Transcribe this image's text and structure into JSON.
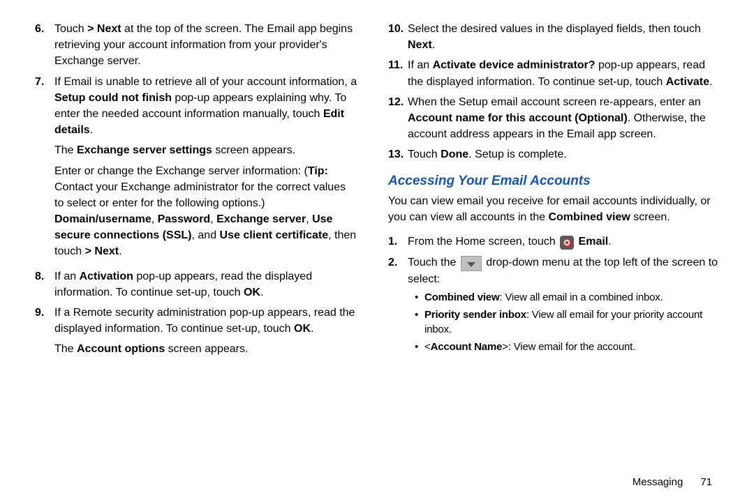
{
  "left": {
    "items": [
      {
        "num": "6.",
        "segs": [
          {
            "t": "Touch "
          },
          {
            "t": "> Next",
            "b": true
          },
          {
            "t": " at the top of the screen. The Email app begins retrieving your account information from your provider's Exchange server."
          }
        ]
      },
      {
        "num": "7.",
        "segs": [
          {
            "t": "If Email is unable to retrieve all of your account information, a "
          },
          {
            "t": "Setup could not finish",
            "b": true
          },
          {
            "t": " pop-up appears explaining why. To enter the needed account information manually, touch "
          },
          {
            "t": "Edit details",
            "b": true
          },
          {
            "t": "."
          }
        ],
        "paras": [
          [
            {
              "t": "The "
            },
            {
              "t": "Exchange server settings",
              "b": true
            },
            {
              "t": " screen appears."
            }
          ],
          [
            {
              "t": "Enter or change the Exchange server information: ("
            },
            {
              "t": "Tip:",
              "b": true
            },
            {
              "t": " Contact your Exchange administrator for the correct values to select or enter for the following options.) "
            },
            {
              "t": "Domain/username",
              "b": true
            },
            {
              "t": ", "
            },
            {
              "t": "Password",
              "b": true
            },
            {
              "t": ", "
            },
            {
              "t": "Exchange server",
              "b": true
            },
            {
              "t": ", "
            },
            {
              "t": "Use secure connections (SSL)",
              "b": true
            },
            {
              "t": ", and "
            },
            {
              "t": "Use client certificate",
              "b": true
            },
            {
              "t": ", then touch "
            },
            {
              "t": "> Next",
              "b": true
            },
            {
              "t": "."
            }
          ]
        ]
      },
      {
        "num": "8.",
        "segs": [
          {
            "t": "If an "
          },
          {
            "t": "Activation",
            "b": true
          },
          {
            "t": " pop-up appears, read the displayed information. To continue set-up, touch "
          },
          {
            "t": "OK",
            "b": true
          },
          {
            "t": "."
          }
        ]
      },
      {
        "num": "9.",
        "segs": [
          {
            "t": "If a Remote security administration pop-up appears, read the displayed information. To continue set-up, touch "
          },
          {
            "t": "OK",
            "b": true
          },
          {
            "t": "."
          }
        ],
        "paras": [
          [
            {
              "t": "The "
            },
            {
              "t": "Account options",
              "b": true
            },
            {
              "t": " screen appears."
            }
          ]
        ]
      }
    ]
  },
  "right": {
    "items": [
      {
        "num": "10.",
        "segs": [
          {
            "t": "Select the desired values in the displayed fields, then touch "
          },
          {
            "t": "Next",
            "b": true
          },
          {
            "t": "."
          }
        ]
      },
      {
        "num": "11.",
        "segs": [
          {
            "t": "If an "
          },
          {
            "t": "Activate device administrator?",
            "b": true
          },
          {
            "t": " pop-up appears, read the displayed information. To continue set-up, touch "
          },
          {
            "t": "Activate",
            "b": true
          },
          {
            "t": "."
          }
        ]
      },
      {
        "num": "12.",
        "segs": [
          {
            "t": "When the Setup email account screen re-appears, enter an "
          },
          {
            "t": "Account name for this account (Optional)",
            "b": true
          },
          {
            "t": ". Otherwise, the account address appears in the Email app screen."
          }
        ]
      },
      {
        "num": "13.",
        "segs": [
          {
            "t": "Touch "
          },
          {
            "t": "Done",
            "b": true
          },
          {
            "t": ". Setup is complete."
          }
        ]
      }
    ],
    "heading": "Accessing Your Email Accounts",
    "intro": [
      {
        "t": "You can view email you receive for email accounts individually, or you can view all accounts in the "
      },
      {
        "t": "Combined view",
        "b": true
      },
      {
        "t": " screen."
      }
    ],
    "steps": [
      {
        "num": "1.",
        "segs": [
          {
            "t": "From the Home screen, touch "
          },
          {
            "icon": "email"
          },
          {
            "t": " "
          },
          {
            "t": "Email",
            "b": true
          },
          {
            "t": "."
          }
        ]
      },
      {
        "num": "2.",
        "segs": [
          {
            "t": "Touch the "
          },
          {
            "icon": "dropdown"
          },
          {
            "t": " drop-down menu at the top left of the screen to select:"
          }
        ],
        "bullets": [
          [
            {
              "t": "Combined view",
              "b": true
            },
            {
              "t": ": View all email in a combined inbox."
            }
          ],
          [
            {
              "t": "Priority sender inbox",
              "b": true
            },
            {
              "t": ": View all email for your priority account inbox."
            }
          ],
          [
            {
              "t": "<"
            },
            {
              "t": "Account Name",
              "b": true
            },
            {
              "t": ">: View email for the account."
            }
          ]
        ]
      }
    ]
  },
  "footer": {
    "section": "Messaging",
    "page": "71"
  }
}
